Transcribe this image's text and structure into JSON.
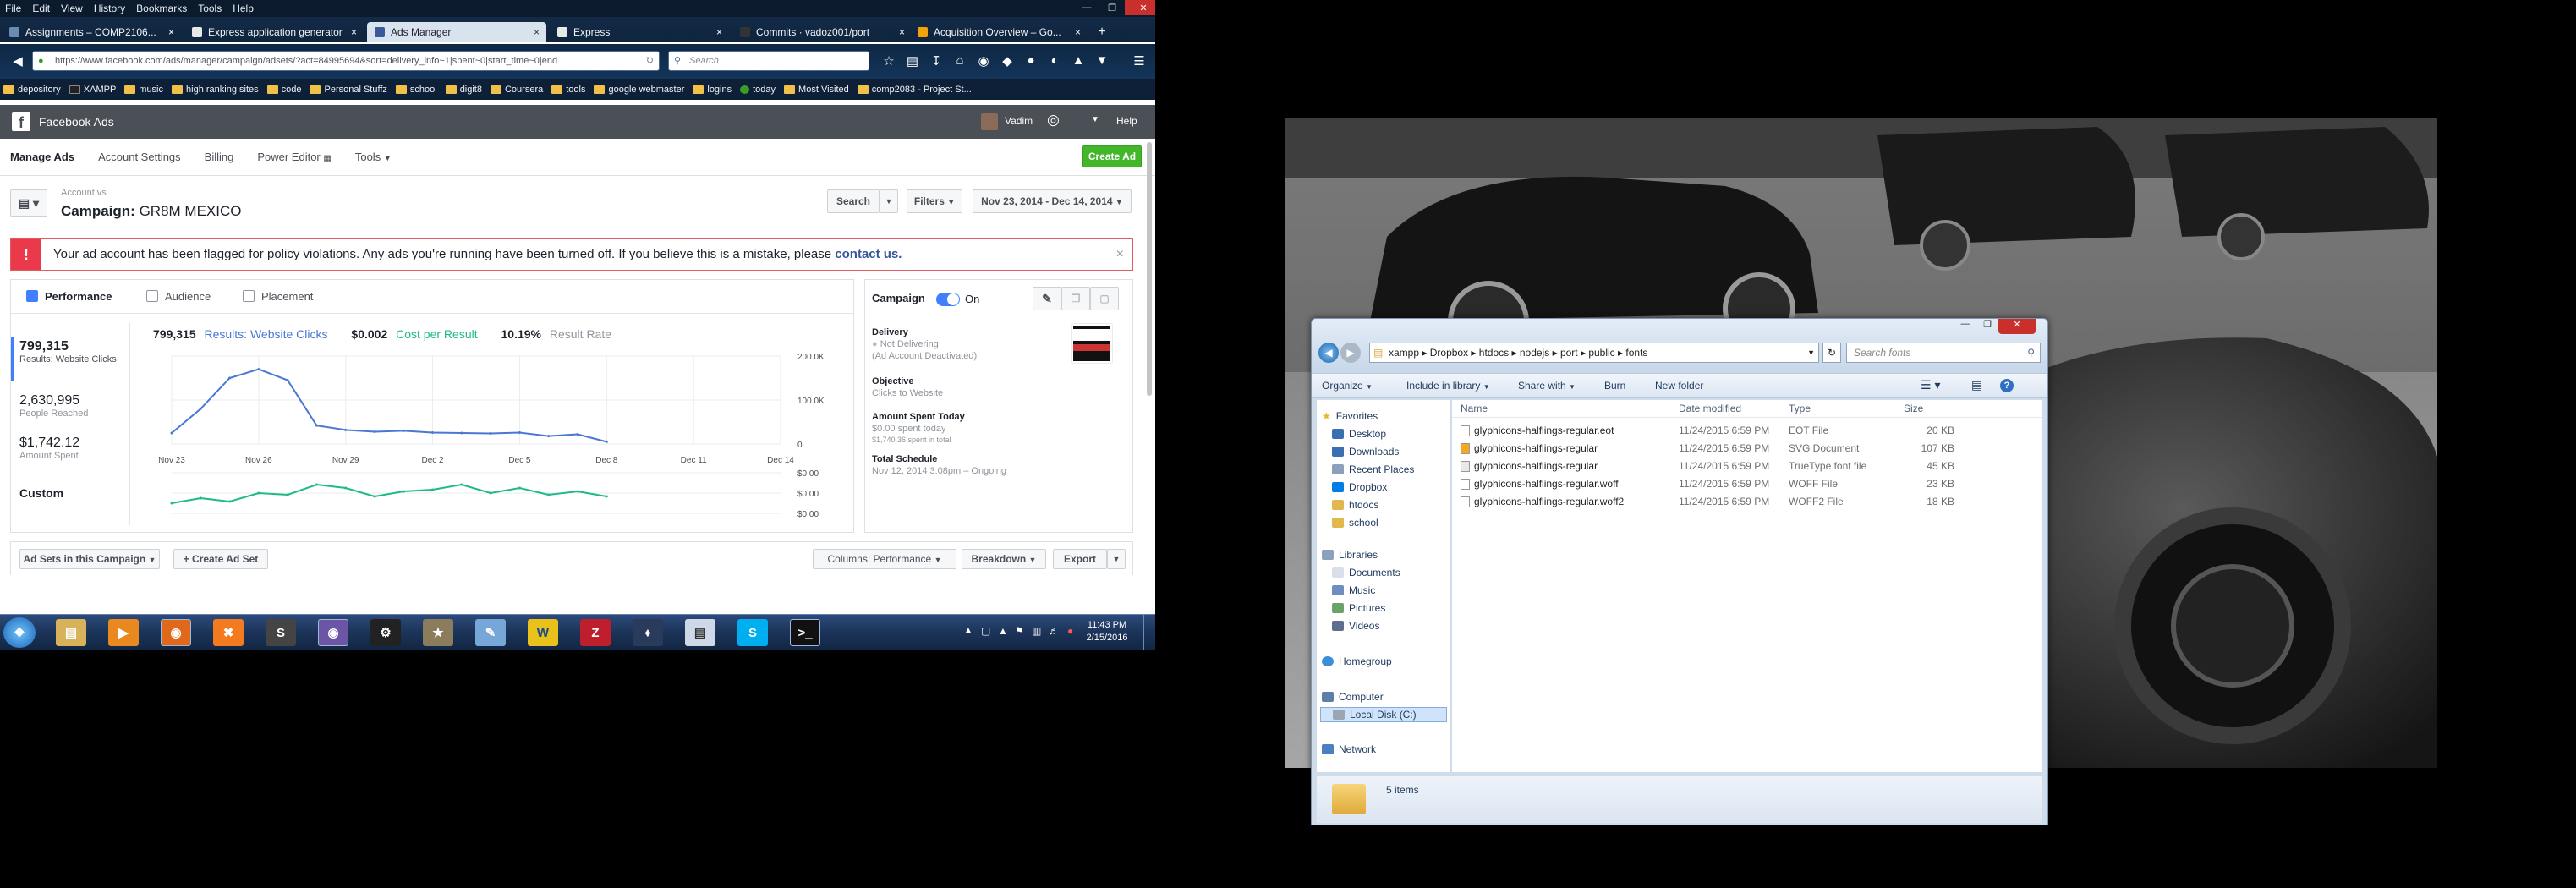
{
  "browser": {
    "menu": [
      "File",
      "Edit",
      "View",
      "History",
      "Bookmarks",
      "Tools",
      "Help"
    ],
    "tabs": [
      {
        "label": "Assignments – COMP2106...",
        "color": "#6b8bb5"
      },
      {
        "label": "Express application generator",
        "color": "#e8e8e8"
      },
      {
        "label": "Ads Manager",
        "color": "#3b5998"
      },
      {
        "label": "Express",
        "color": "#e8e8e8"
      },
      {
        "label": "Commits · vadoz001/port",
        "color": "#333333"
      },
      {
        "label": "Acquisition Overview – Go...",
        "color": "#f4a20c"
      }
    ],
    "new_tab": "+",
    "url": "https://www.facebook.com/ads/manager/campaign/adsets/?act=84995694&sort=delivery_info~1|spent~0|start_time~0|end",
    "search_placeholder": "Search",
    "bookmarks": [
      "depository",
      "XAMPP",
      "music",
      "high ranking sites",
      "code",
      "Personal Stuffz",
      "school",
      "digit8",
      "Coursera",
      "tools",
      "google webmaster",
      "logins",
      "today",
      "Most Visited",
      "comp2083 - Project St..."
    ]
  },
  "fb": {
    "brand": "Facebook Ads",
    "user": "Vadim",
    "help": "Help",
    "subnav": [
      "Manage Ads",
      "Account Settings",
      "Billing",
      "Power Editor",
      "Tools"
    ],
    "create_ad": "Create Ad",
    "account": "Account vs",
    "campaign_prefix": "Campaign:",
    "campaign_name": "GR8M MEXICO",
    "search_btn": "Search",
    "filters_btn": "Filters",
    "date_range": "Nov 23, 2014 - Dec 14, 2014",
    "alert_text": "Your ad account has been flagged for policy violations. Any ads you're running have been turned off. If you believe this is a mistake, please",
    "alert_link": "contact us.",
    "tabs": [
      "Performance",
      "Audience",
      "Placement"
    ],
    "metrics": [
      {
        "value": "799,315",
        "label": "Results: Website Clicks"
      },
      {
        "value": "2,630,995",
        "label": "People Reached"
      },
      {
        "value": "$1,742.12",
        "label": "Amount Spent"
      },
      {
        "value": "Custom",
        "label": ""
      }
    ],
    "summary": {
      "results_value": "799,315",
      "results_label": "Results: Website Clicks",
      "cpr_value": "$0.002",
      "cpr_label": "Cost per Result",
      "rate_value": "10.19%",
      "rate_label": "Result Rate"
    },
    "side": {
      "campaign_label": "Campaign",
      "toggle_label": "On",
      "delivery_title": "Delivery",
      "delivery_status": "Not Delivering",
      "delivery_note": "(Ad Account Deactivated)",
      "objective_title": "Objective",
      "objective_value": "Clicks to Website",
      "spent_title": "Amount Spent Today",
      "spent_value": "$0.00 spent today",
      "spent_total": "$1,740.36 spent in total",
      "schedule_title": "Total Schedule",
      "schedule_value": "Nov 12, 2014 3:08pm – Ongoing"
    },
    "bottom": {
      "adsets_btn": "Ad Sets in this Campaign",
      "create_adset_btn": "+ Create Ad Set",
      "columns_btn": "Columns: Performance",
      "breakdown_btn": "Breakdown",
      "export_btn": "Export"
    }
  },
  "chart_data": [
    {
      "type": "line",
      "x": [
        "Nov 23",
        "Nov 24",
        "Nov 25",
        "Nov 26",
        "Nov 27",
        "Nov 28",
        "Nov 29",
        "Nov 30",
        "Dec 1",
        "Dec 2",
        "Dec 3",
        "Dec 4",
        "Dec 5",
        "Dec 6",
        "Dec 7",
        "Dec 8"
      ],
      "x_ticks": [
        "Nov 23",
        "Nov 26",
        "Nov 29",
        "Dec 2",
        "Dec 5",
        "Dec 8",
        "Dec 11",
        "Dec 14"
      ],
      "series": [
        {
          "values": [
            25000,
            80000,
            150000,
            170000,
            145000,
            42000,
            32000,
            28000,
            30000,
            26000,
            25000,
            24000,
            26000,
            18000,
            22000,
            5000
          ]
        }
      ],
      "y_ticks": [
        "200.0K",
        "100.0K",
        "0"
      ],
      "ylim": [
        0,
        200000
      ],
      "color": "#4a77d4"
    },
    {
      "type": "line",
      "x": [
        "Nov 23",
        "Nov 24",
        "Nov 25",
        "Nov 26",
        "Nov 27",
        "Nov 28",
        "Nov 29",
        "Nov 30",
        "Dec 1",
        "Dec 2",
        "Dec 3",
        "Dec 4",
        "Dec 5",
        "Dec 6",
        "Dec 7",
        "Dec 8"
      ],
      "series": [
        {
          "values": [
            0.2,
            0.35,
            0.25,
            0.5,
            0.45,
            0.75,
            0.65,
            0.4,
            0.55,
            0.6,
            0.75,
            0.5,
            0.65,
            0.45,
            0.55,
            0.4
          ]
        }
      ],
      "y_ticks": [
        "$0.00",
        "$0.00",
        "$0.00"
      ],
      "color": "#1fb98b"
    }
  ],
  "taskbar": {
    "time": "11:43 PM",
    "date": "2/15/2016",
    "apps": [
      "IE",
      "Explorer",
      "Media",
      "Firefox",
      "XAMPP",
      "Sublime",
      "App",
      "Steam",
      "App",
      "Notes",
      "WebStorm",
      "FileZilla",
      "App",
      "Notepad",
      "Skype",
      "Cmd"
    ]
  },
  "explorer": {
    "path": [
      "xampp",
      "Dropbox",
      "htdocs",
      "nodejs",
      "port",
      "public",
      "fonts"
    ],
    "search_placeholder": "Search fonts",
    "toolbar": [
      "Organize",
      "Include in library",
      "Share with",
      "Burn",
      "New folder"
    ],
    "nav": {
      "favorites_header": "Favorites",
      "favorites": [
        "Desktop",
        "Downloads",
        "Recent Places",
        "Dropbox",
        "htdocs",
        "school"
      ],
      "libraries_header": "Libraries",
      "libraries": [
        "Documents",
        "Music",
        "Pictures",
        "Videos"
      ],
      "homegroup": "Homegroup",
      "computer": "Computer",
      "disk": "Local Disk (C:)",
      "network": "Network"
    },
    "columns": [
      "Name",
      "Date modified",
      "Type",
      "Size"
    ],
    "files": [
      {
        "name": "glyphicons-halflings-regular.eot",
        "date": "11/24/2015 6:59 PM",
        "type": "EOT File",
        "size": "20 KB"
      },
      {
        "name": "glyphicons-halflings-regular",
        "date": "11/24/2015 6:59 PM",
        "type": "SVG Document",
        "size": "107 KB"
      },
      {
        "name": "glyphicons-halflings-regular",
        "date": "11/24/2015 6:59 PM",
        "type": "TrueType font file",
        "size": "45 KB"
      },
      {
        "name": "glyphicons-halflings-regular.woff",
        "date": "11/24/2015 6:59 PM",
        "type": "WOFF File",
        "size": "23 KB"
      },
      {
        "name": "glyphicons-halflings-regular.woff2",
        "date": "11/24/2015 6:59 PM",
        "type": "WOFF2 File",
        "size": "18 KB"
      }
    ],
    "status": "5 items"
  }
}
